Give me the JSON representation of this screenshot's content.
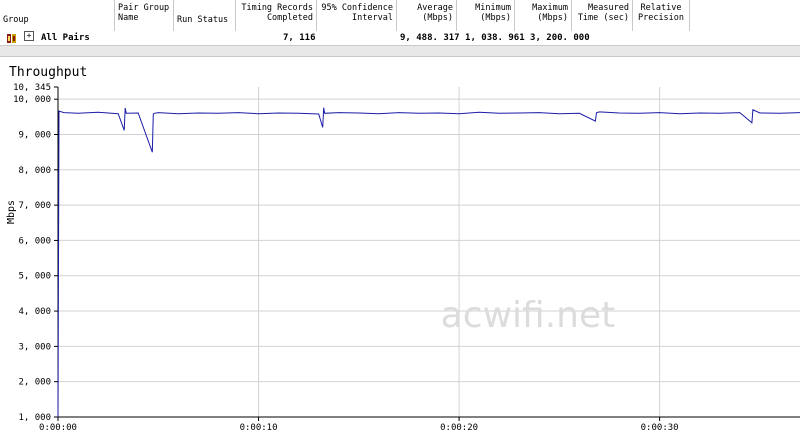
{
  "columns": [
    {
      "label": "Group"
    },
    {
      "label": "Pair Group\nName"
    },
    {
      "label": "Run Status"
    },
    {
      "label": "Timing Records\nCompleted"
    },
    {
      "label": "95% Confidence\nInterval"
    },
    {
      "label": "Average\n(Mbps)"
    },
    {
      "label": "Minimum\n(Mbps)"
    },
    {
      "label": "Maximum\n(Mbps)"
    },
    {
      "label": "Measured\nTime (sec)"
    },
    {
      "label": "Relative\nPrecision"
    }
  ],
  "row": {
    "expand": "+",
    "group": "All Pairs",
    "records": "7, 116",
    "stats": "9, 488. 317 1, 038. 961 3, 200. 000"
  },
  "chart": {
    "title": "Throughput",
    "watermark": "acwifi.net"
  },
  "colors": {
    "line": "#1c1ca8",
    "grid": "#d2d2d2",
    "axis": "#000000"
  },
  "chart_data": {
    "type": "line",
    "title": "Throughput",
    "ylabel": "Mbps",
    "ylim": [
      1000,
      10345
    ],
    "y_ticks": [
      "10, 345",
      "10, 000",
      "9, 000",
      "8, 000",
      "7, 000",
      "6, 000",
      "5, 000",
      "4, 000",
      "3, 000",
      "2, 000",
      "1, 000"
    ],
    "x_ticks": [
      "0:00:00",
      "0:00:10",
      "0:00:20",
      "0:00:30"
    ],
    "x_tick_seconds": [
      0,
      10,
      20,
      30
    ],
    "xlim_seconds": [
      0,
      37
    ],
    "series": [
      {
        "x": [
          0,
          0.05,
          0.3,
          1,
          2,
          3,
          3.3,
          3.35,
          3.4,
          4,
          4.7,
          4.75,
          4.8,
          5,
          6,
          7,
          8,
          9,
          10,
          11,
          12,
          13,
          13.2,
          13.25,
          13.3,
          14,
          15,
          16,
          17,
          18,
          19,
          20,
          21,
          22,
          23,
          24,
          25,
          26,
          26.8,
          26.85,
          27,
          28,
          29,
          30,
          31,
          32,
          33,
          34,
          34.6,
          34.65,
          35,
          36,
          37
        ],
        "values": [
          1000,
          9660,
          9620,
          9600,
          9630,
          9590,
          9120,
          9750,
          9600,
          9610,
          8500,
          9580,
          9600,
          9620,
          9590,
          9610,
          9600,
          9620,
          9590,
          9610,
          9600,
          9580,
          9200,
          9760,
          9600,
          9620,
          9610,
          9590,
          9620,
          9600,
          9610,
          9590,
          9630,
          9600,
          9610,
          9620,
          9590,
          9600,
          9380,
          9620,
          9640,
          9610,
          9600,
          9620,
          9590,
          9610,
          9600,
          9620,
          9330,
          9700,
          9610,
          9600,
          9620
        ]
      }
    ]
  }
}
